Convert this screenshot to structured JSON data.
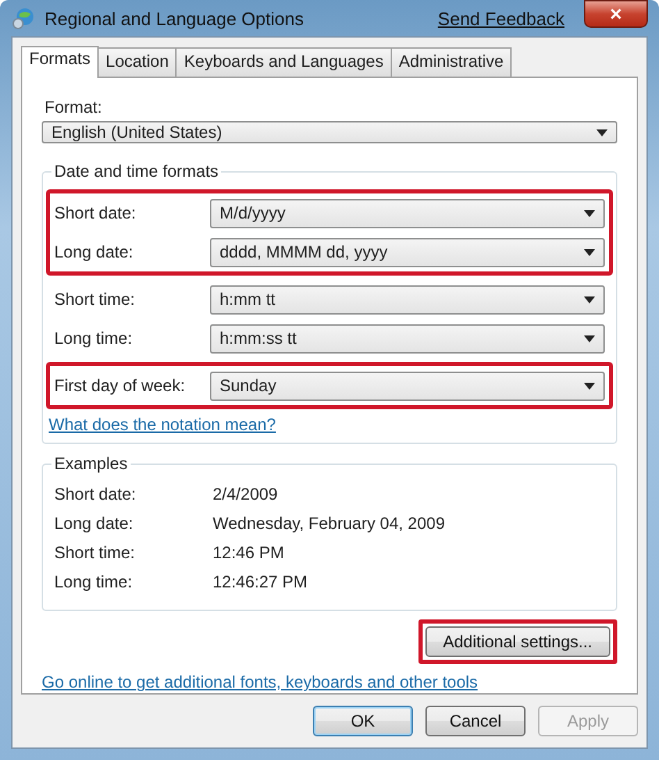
{
  "window": {
    "title": "Regional and Language Options",
    "feedback_link": "Send Feedback",
    "close": "×"
  },
  "tabs": [
    {
      "label": "Formats",
      "selected": true
    },
    {
      "label": "Location",
      "selected": false
    },
    {
      "label": "Keyboards and Languages",
      "selected": false
    },
    {
      "label": "Administrative",
      "selected": false
    }
  ],
  "format": {
    "label": "Format:",
    "value": "English (United States)"
  },
  "date_time_formats": {
    "title": "Date and time formats",
    "groups": [
      {
        "highlighted": true,
        "rows": [
          {
            "label": "Short date:",
            "value": "M/d/yyyy"
          },
          {
            "label": "Long date:",
            "value": "dddd, MMMM dd, yyyy"
          }
        ]
      },
      {
        "highlighted": false,
        "rows": [
          {
            "label": "Short time:",
            "value": "h:mm tt"
          },
          {
            "label": "Long time:",
            "value": "h:mm:ss tt"
          }
        ]
      },
      {
        "highlighted": true,
        "rows": [
          {
            "label": "First day of week:",
            "value": "Sunday"
          }
        ]
      }
    ],
    "link": "What does the notation mean?"
  },
  "examples": {
    "title": "Examples",
    "rows": [
      {
        "label": "Short date:",
        "value": "2/4/2009"
      },
      {
        "label": "Long date:",
        "value": "Wednesday, February 04, 2009"
      },
      {
        "label": "Short time:",
        "value": "12:46 PM"
      },
      {
        "label": "Long time:",
        "value": "12:46:27 PM"
      }
    ]
  },
  "additional_settings": {
    "label": "Additional settings...",
    "highlighted": true
  },
  "online_link": "Go online to get additional fonts, keyboards and other tools",
  "buttons": [
    {
      "label": "OK",
      "disabled": false,
      "default": true
    },
    {
      "label": "Cancel",
      "disabled": false,
      "default": false
    },
    {
      "label": "Apply",
      "disabled": true,
      "default": false
    }
  ]
}
